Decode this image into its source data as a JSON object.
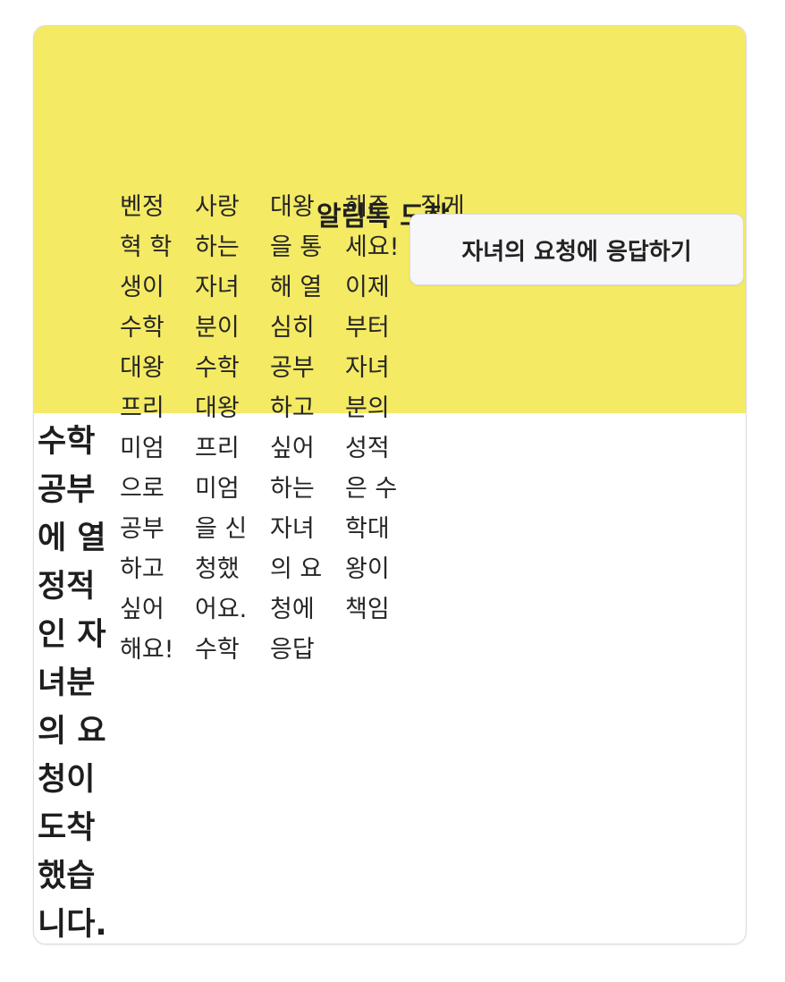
{
  "notification": {
    "title": "알림톡 도착",
    "heading": "수학 공부에 열정적인 자녀분의 요청이 도착했습니다.",
    "body_paragraph_1": "벤정혁 학생이 수학대왕 프리미엄으로 공부하고 싶어해요!",
    "body_paragraph_2": "사랑하는 자녀분이 수학대왕 프리미엄을 신청했어요.",
    "body_paragraph_3": "수학대왕을 통해 열심히 공부하고 싶어하는 자녀의 요청에 응답해주세요!",
    "body_paragraph_4": "이제부터 자녀분의 성적은 수학대왕이 책임질게요",
    "emoji": "😁",
    "button_label": "자녀의 요청에 응답하기"
  },
  "colors": {
    "header_background": "#f4ea64",
    "card_background": "#ffffff",
    "button_background": "#f7f7f9",
    "text": "#222222"
  }
}
